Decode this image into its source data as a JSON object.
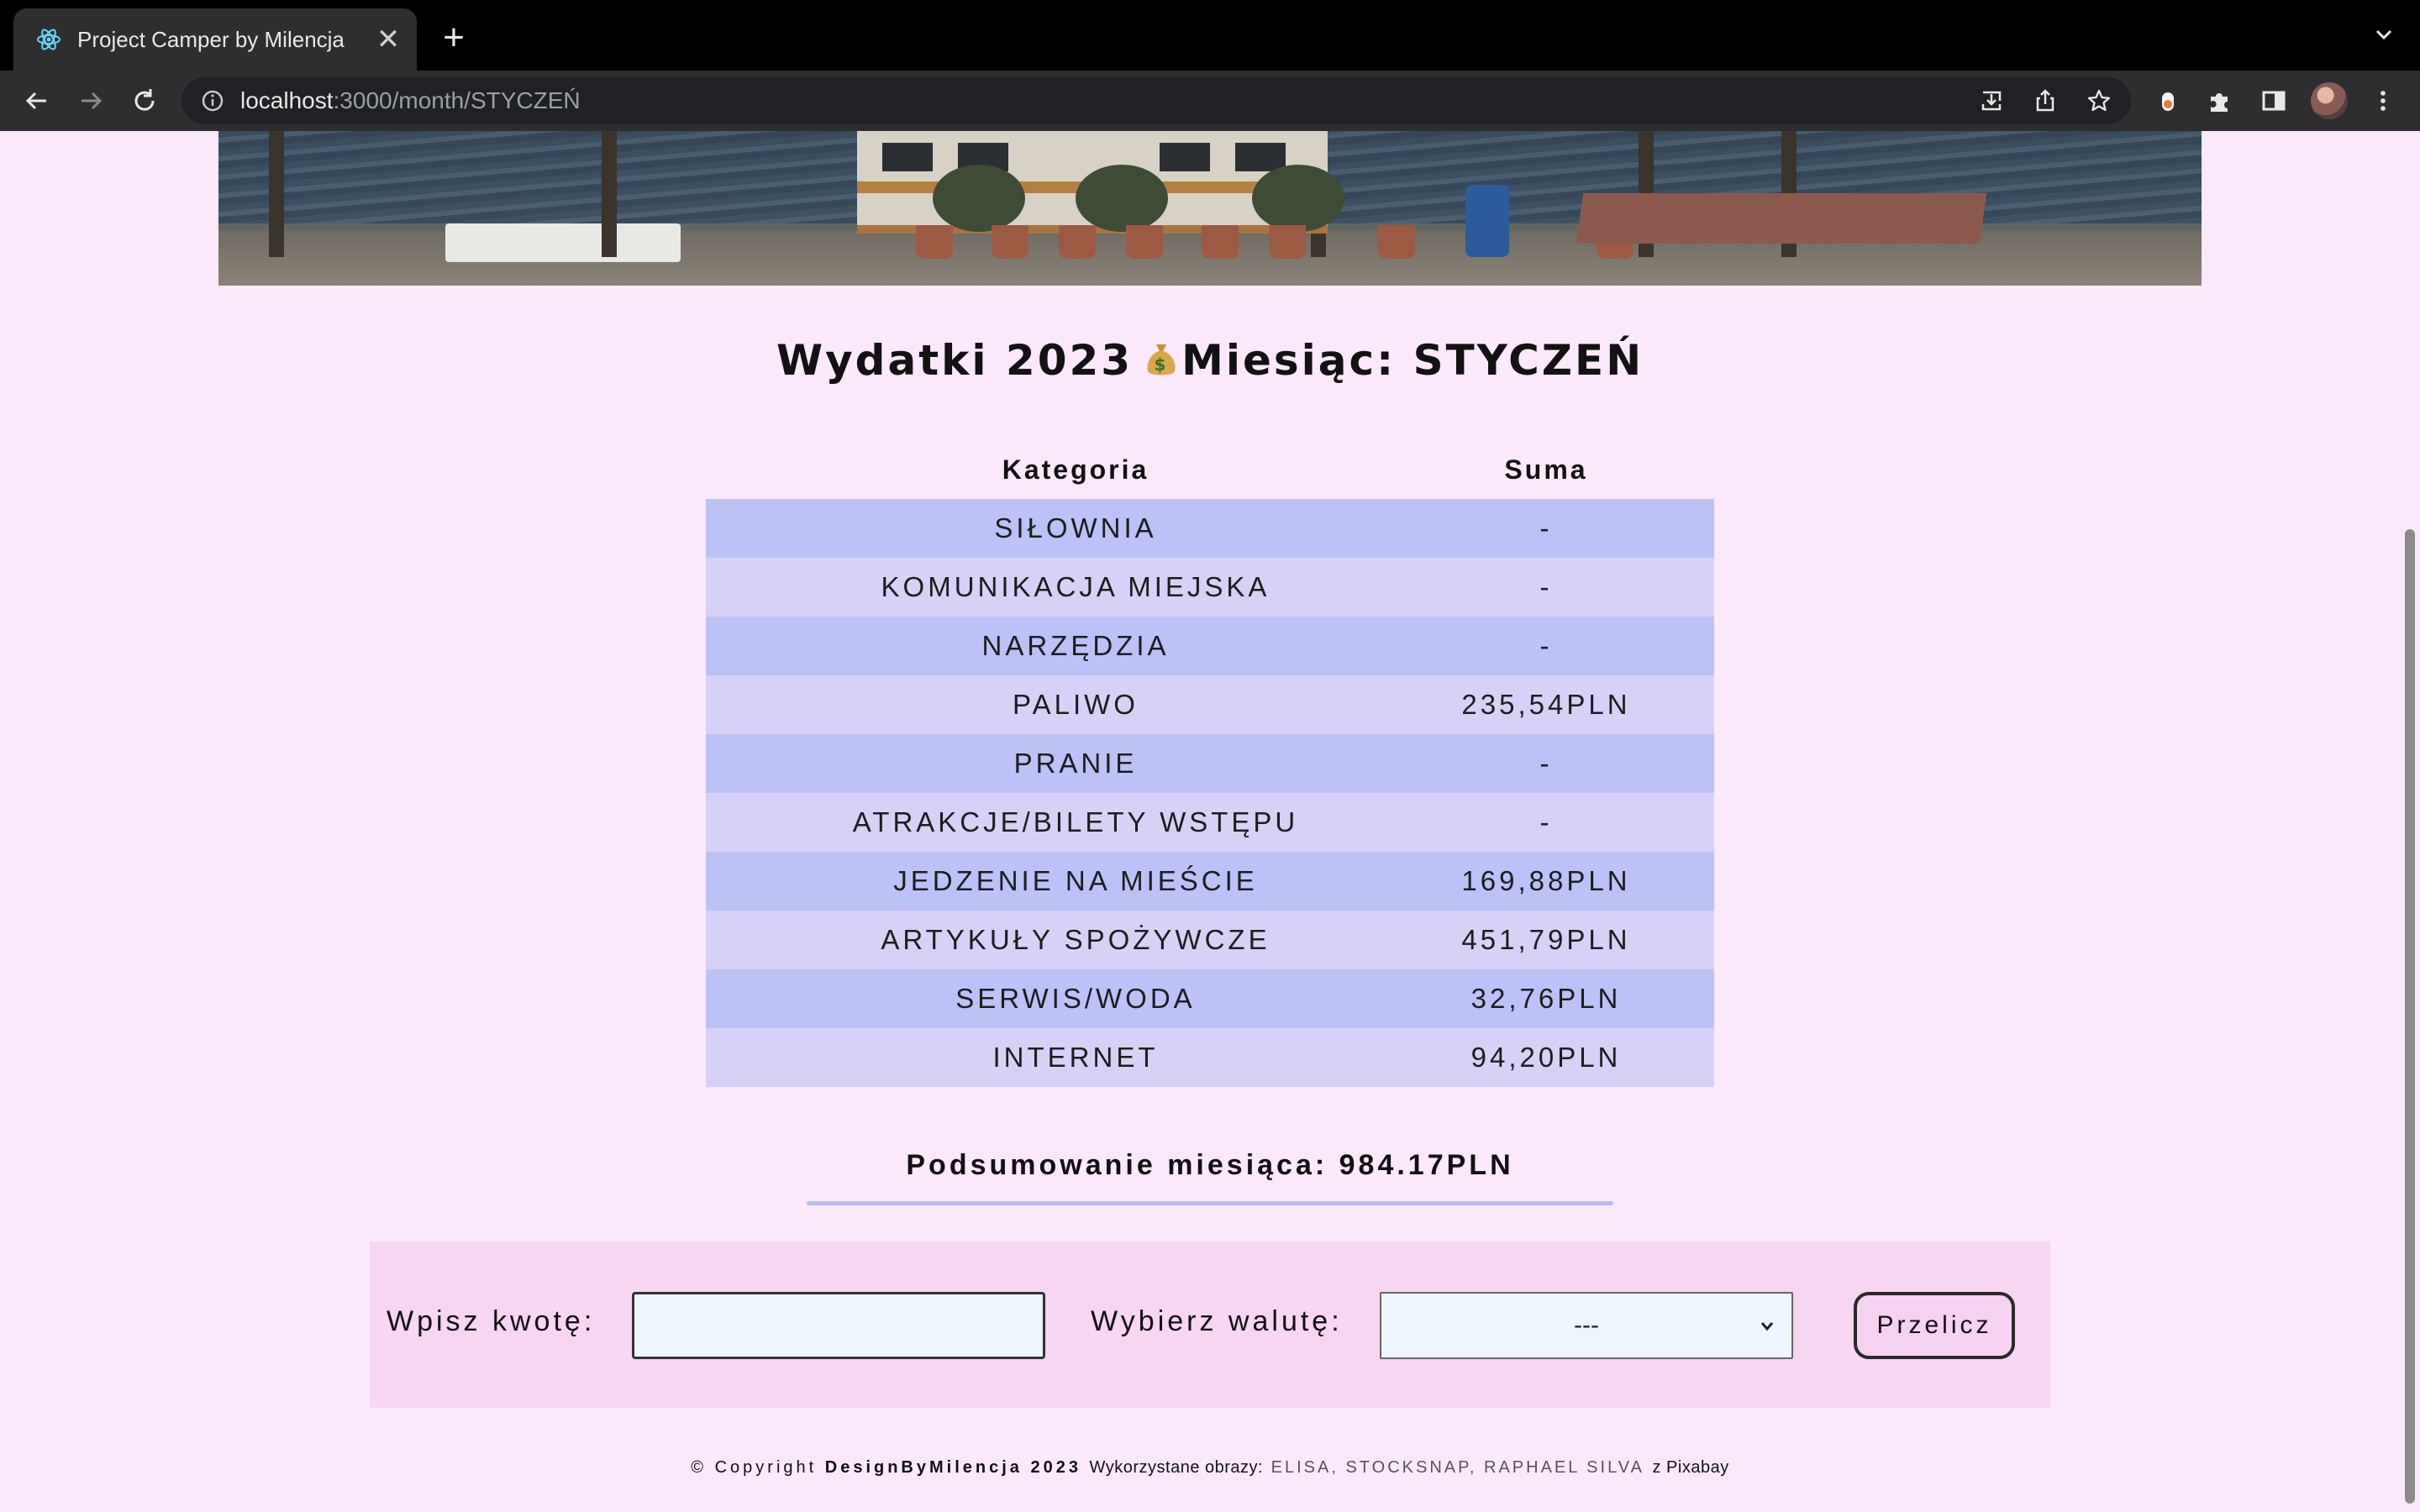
{
  "browser": {
    "tab_title": "Project Camper by Milencja",
    "tab_close": "✕",
    "new_tab": "+",
    "url_host": "localhost",
    "url_path": ":3000/month/STYCZEŃ"
  },
  "page": {
    "heading_left": "Wydatki 2023",
    "heading_right": "Miesiąc: STYCZEŃ",
    "table": {
      "headers": [
        "Kategoria",
        "Suma"
      ],
      "rows": [
        {
          "category": "SIŁOWNIA",
          "sum": "-"
        },
        {
          "category": "KOMUNIKACJA MIEJSKA",
          "sum": "-"
        },
        {
          "category": "NARZĘDZIA",
          "sum": "-"
        },
        {
          "category": "PALIWO",
          "sum": "235,54PLN"
        },
        {
          "category": "PRANIE",
          "sum": "-"
        },
        {
          "category": "ATRAKCJE/BILETY WSTĘPU",
          "sum": "-"
        },
        {
          "category": "JEDZENIE NA MIEŚCIE",
          "sum": "169,88PLN"
        },
        {
          "category": "ARTYKUŁY SPOŻYWCZE",
          "sum": "451,79PLN"
        },
        {
          "category": "SERWIS/WODA",
          "sum": "32,76PLN"
        },
        {
          "category": "INTERNET",
          "sum": "94,20PLN"
        }
      ]
    },
    "summary": "Podsumowanie miesiąca: 984.17PLN",
    "converter": {
      "amount_label": "Wpisz kwotę:",
      "amount_value": "",
      "currency_label": "Wybierz walutę:",
      "currency_selected": "---",
      "button_label": "Przelicz"
    },
    "footer": {
      "copyright": "© Copyright",
      "brand": "DesignByMilencja 2023",
      "images_label": "Wykorzystane obrazy:",
      "authors": "ELISA, STOCKSNAP, RAPHAEL SILVA",
      "source": "z Pixabay"
    }
  },
  "colors": {
    "page_bg": "#fbe9fb",
    "row_odd": "#bcc2f6",
    "row_even": "#d7d1f8",
    "converter_bg": "#f7d5f3",
    "summary_line": "#b9bcf2"
  },
  "icons": [
    "react-favicon-icon",
    "close-icon",
    "plus-icon",
    "chevron-down-icon",
    "back-arrow-icon",
    "forward-arrow-icon",
    "reload-icon",
    "info-icon",
    "install-icon",
    "share-icon",
    "star-icon",
    "extension-icon",
    "puzzle-icon",
    "side-panel-icon",
    "more-icon",
    "money-bag-icon"
  ]
}
